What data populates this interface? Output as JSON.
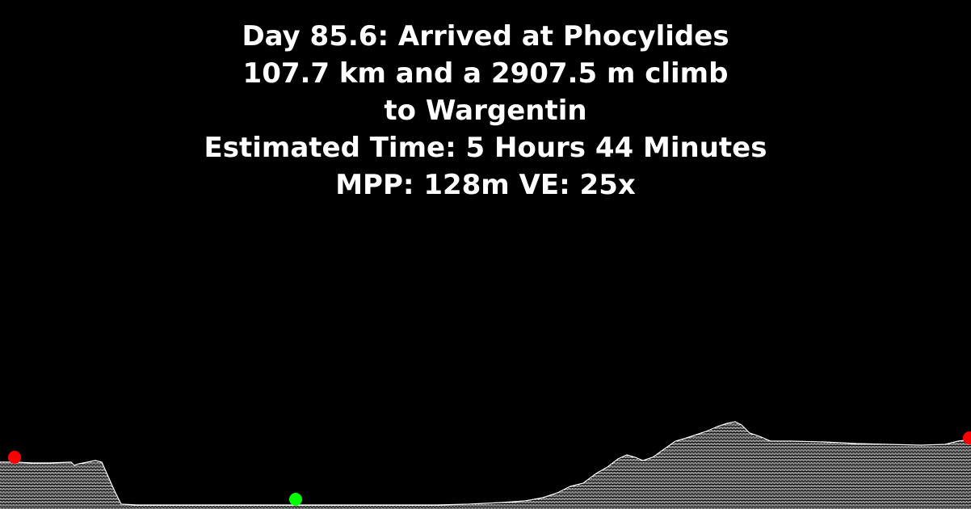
{
  "header": {
    "line1": "Day 85.6: Arrived at Phocylides",
    "line2": "107.7 km and a 2907.5 m climb",
    "line3": "to Wargentin",
    "line4": "Estimated Time: 5 Hours 44 Minutes",
    "line5": "MPP: 128m VE: 25x"
  },
  "colors": {
    "background": "#000000",
    "text": "#ffffff",
    "terrain_fill": "#d8d8d8",
    "start_marker": "#ff0000",
    "end_marker": "#ff0000",
    "current_marker": "#00ff00"
  }
}
